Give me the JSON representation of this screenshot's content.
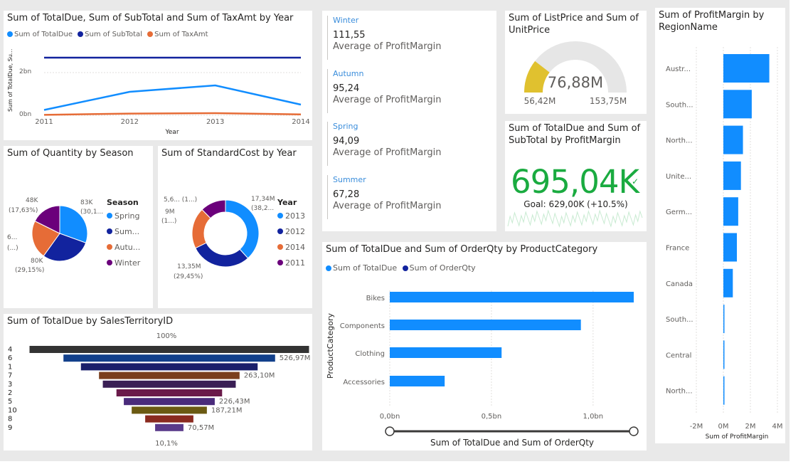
{
  "colors": {
    "blue": "#118dff",
    "navy": "#12239e",
    "orange": "#e66c37",
    "purple": "#6b007b",
    "green": "#1aab40",
    "gold": "#e0c12f",
    "gaugebg": "#e6e6e6"
  },
  "line_card": {
    "title": "Sum of TotalDue, Sum of SubTotal and Sum of TaxAmt by Year",
    "legend": [
      "Sum of TotalDue",
      "Sum of SubTotal",
      "Sum of TaxAmt"
    ],
    "ylabel": "Sum of TotalDue, Su...",
    "xlabel": "Year",
    "yticks": [
      "2bn",
      "0bn"
    ]
  },
  "season_card": {
    "title": "Sum of Quantity by Season",
    "legend_title": "Season",
    "legend": [
      "Spring",
      "Sum...",
      "Autu...",
      "Winter"
    ],
    "labels": {
      "spring": [
        "83K",
        "(30,1..."
      ],
      "summer": [
        "80K",
        "(29,15%)"
      ],
      "autumn": [
        "6...",
        "(...)"
      ],
      "winter": [
        "48K",
        "(17,63%)"
      ]
    }
  },
  "cost_card": {
    "title": "Sum of StandardCost by Year",
    "legend_title": "Year",
    "legend": [
      "2013",
      "2012",
      "2014",
      "2011"
    ],
    "labels": {
      "y2013": [
        "17,34M",
        "(38,2..."
      ],
      "y2012": [
        "13,35M",
        "(29,45%)"
      ],
      "y2014": [
        "9M",
        "(1...)"
      ],
      "y2011": [
        "5,6... (1...)"
      ]
    }
  },
  "funnel_card": {
    "title": "Sum of TotalDue by SalesTerritoryID",
    "top_label": "100%",
    "bottom_label": "10,1%"
  },
  "kpi_list": [
    {
      "label": "Winter",
      "value": "111,55",
      "sub": "Average of ProfitMargin"
    },
    {
      "label": "Autumn",
      "value": "95,24",
      "sub": "Average of ProfitMargin"
    },
    {
      "label": "Spring",
      "value": "94,09",
      "sub": "Average of ProfitMargin"
    },
    {
      "label": "Summer",
      "value": "67,28",
      "sub": "Average of ProfitMargin"
    }
  ],
  "gauge_card": {
    "title": "Sum of ListPrice and Sum of UnitPrice",
    "value_label": "76,88M",
    "min_label": "56,42M",
    "max_label": "153,75M",
    "value": 76.88,
    "min": 56.42,
    "max": 153.75
  },
  "kpi_card": {
    "title": "Sum of TotalDue and Sum of SubTotal by ProfitMargin",
    "value": "695,04K",
    "goal": "Goal: 629,00K (+10.5%)"
  },
  "bar_card": {
    "title": "Sum of TotalDue and Sum of OrderQty by ProductCategory",
    "legend": [
      "Sum of TotalDue",
      "Sum of OrderQty"
    ],
    "ylabel": "ProductCategory",
    "xlabel": "Sum of TotalDue and Sum of OrderQty",
    "xticks": [
      "0,0bn",
      "0,5bn",
      "1,0bn"
    ]
  },
  "region_card": {
    "title": "Sum of ProfitMargin by RegionName",
    "xlabel": "Sum of ProfitMargin",
    "xticks": [
      "-2M",
      "0M",
      "2M",
      "4M"
    ]
  },
  "chart_data": [
    {
      "type": "line",
      "title": "Sum of TotalDue, Sum of SubTotal and Sum of TaxAmt by Year",
      "xlabel": "Year",
      "ylabel": "Sum of TotalDue, Su...",
      "x": [
        "2011",
        "2012",
        "2013",
        "2014"
      ],
      "ylim": [
        0,
        3.0
      ],
      "series": [
        {
          "name": "Sum of TotalDue",
          "values": [
            0.25,
            1.1,
            1.4,
            0.5
          ]
        },
        {
          "name": "Sum of SubTotal",
          "values": [
            2.7,
            2.7,
            2.7,
            2.7
          ]
        },
        {
          "name": "Sum of TaxAmt",
          "values": [
            0.02,
            0.08,
            0.1,
            0.04
          ]
        }
      ]
    },
    {
      "type": "pie",
      "title": "Sum of Quantity by Season",
      "categories": [
        "Spring",
        "Summer",
        "Autumn",
        "Winter"
      ],
      "values": [
        83,
        80,
        61,
        48
      ],
      "shares": [
        30.1,
        29.15,
        22.3,
        17.63
      ]
    },
    {
      "type": "pie",
      "title": "Sum of StandardCost by Year",
      "categories": [
        "2013",
        "2012",
        "2014",
        "2011"
      ],
      "values": [
        17.34,
        13.35,
        9.0,
        5.6
      ],
      "shares": [
        38.2,
        29.45,
        19.9,
        12.4
      ]
    },
    {
      "type": "bar",
      "title": "Sum of TotalDue by SalesTerritoryID",
      "categories": [
        "4",
        "6",
        "1",
        "7",
        "3",
        "2",
        "5",
        "10",
        "8",
        "9"
      ],
      "values": [
        696,
        526.97,
        440,
        350,
        331,
        263.1,
        226.43,
        187.21,
        120,
        70.57
      ],
      "data_labels": [
        "",
        "526,97M",
        "",
        "263,10M",
        "",
        "",
        "226,43M",
        "187,21M",
        "",
        "70,57M"
      ]
    },
    {
      "type": "bar",
      "title": "Sum of TotalDue and Sum of OrderQty by ProductCategory",
      "categories": [
        "Bikes",
        "Components",
        "Clothing",
        "Accessories"
      ],
      "xlim": [
        0,
        1.2
      ],
      "series": [
        {
          "name": "Sum of TotalDue",
          "values": [
            1.2,
            0.94,
            0.55,
            0.27
          ]
        },
        {
          "name": "Sum of OrderQty",
          "values": [
            0,
            0,
            0,
            0
          ]
        }
      ]
    },
    {
      "type": "bar",
      "title": "Sum of ProfitMargin by RegionName",
      "categories": [
        "Austr...",
        "South...",
        "North...",
        "Unite...",
        "Germ...",
        "France",
        "Canada",
        "South...",
        "Central",
        "North..."
      ],
      "values": [
        3.4,
        2.1,
        1.45,
        1.3,
        1.1,
        1.0,
        0.7,
        0.05,
        0.04,
        0.04
      ],
      "xlim": [
        -2,
        4
      ]
    }
  ]
}
